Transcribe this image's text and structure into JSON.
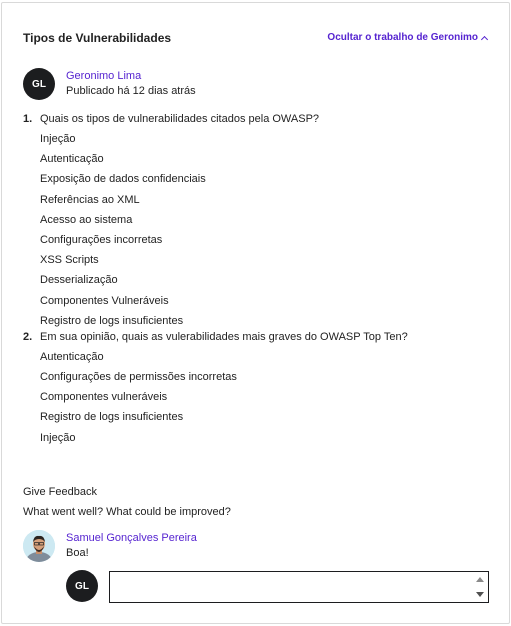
{
  "header": {
    "title": "Tipos de Vulnerabilidades",
    "toggle_label": "Ocultar o trabalho de Geronimo"
  },
  "author": {
    "initials": "GL",
    "name": "Geronimo Lima",
    "meta": "Publicado há 12 dias atrás"
  },
  "questions": [
    {
      "number": "1.",
      "text": "Quais os tipos de vulnerabilidades citados pela OWASP?",
      "answers": [
        "Injeção",
        "Autenticação",
        "Exposição de dados confidenciais",
        "Referências ao XML",
        "Acesso ao sistema",
        "Configurações incorretas",
        "XSS Scripts",
        "Desserialização",
        "Componentes Vulneráveis",
        "Registro de logs insuficientes"
      ]
    },
    {
      "number": "2.",
      "text": "Em sua opinião, quais as vulerabilidades mais graves do OWASP Top Ten?",
      "answers": [
        "Autenticação",
        "Configurações de permissões incorretas",
        "Componentes vulneráveis",
        "Registro de logs insuficientes",
        "Injeção"
      ]
    }
  ],
  "feedback": {
    "title": "Give Feedback",
    "prompt": "What went well? What could be improved?"
  },
  "comment": {
    "name": "Samuel Gonçalves Pereira",
    "text": "Boa!"
  },
  "reply": {
    "initials": "GL",
    "value": ""
  },
  "colors": {
    "accent": "#5624d0",
    "avatar_bg": "#1c1d1f"
  },
  "icons": {
    "toggle": "chevron-up-icon"
  }
}
